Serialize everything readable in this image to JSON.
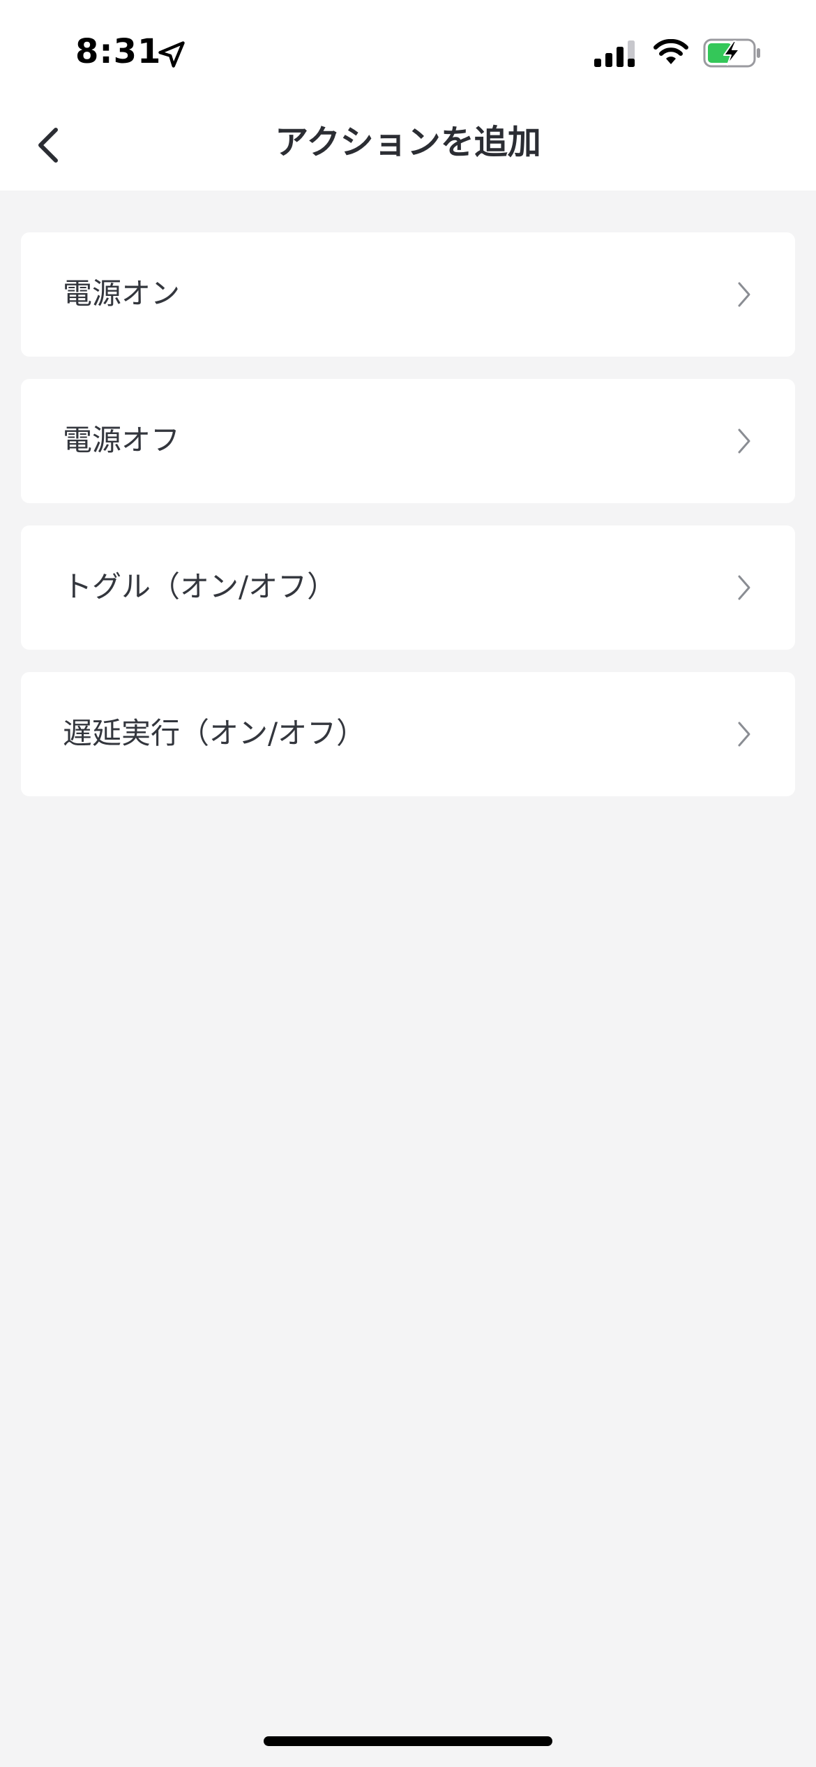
{
  "status_bar": {
    "time": "8:31",
    "icons": [
      "location-arrow-icon",
      "cellular-signal-icon",
      "wifi-icon",
      "battery-charging-icon"
    ],
    "battery_color": "#34c759"
  },
  "nav": {
    "title": "アクションを追加",
    "back_icon": "chevron-left-icon"
  },
  "actions": [
    {
      "label": "電源オン"
    },
    {
      "label": "電源オフ"
    },
    {
      "label": "トグル（オン/オフ）"
    },
    {
      "label": "遅延実行（オン/オフ）"
    }
  ],
  "colors": {
    "background": "#f4f4f5",
    "card": "#ffffff",
    "text": "#33363d",
    "chevron": "#8a8d93"
  }
}
